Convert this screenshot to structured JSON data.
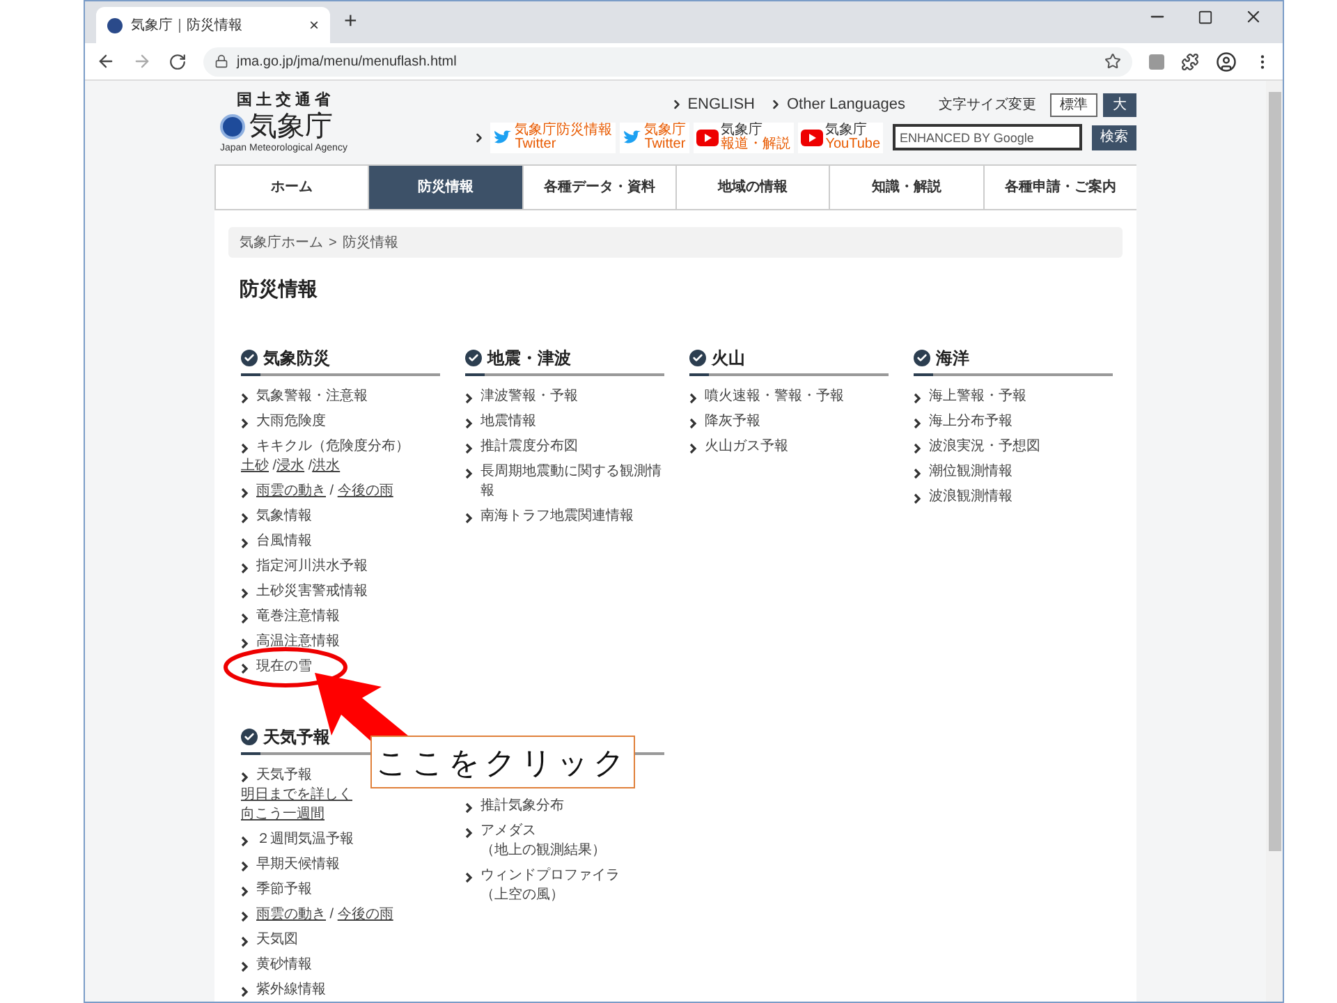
{
  "browser": {
    "tab": {
      "title": "気象庁｜防災情報",
      "close": "×"
    },
    "new_tab": "+",
    "url": "jma.go.jp/jma/menu/menuflash.html"
  },
  "header": {
    "logo": {
      "ministry": "国土交通省",
      "name": "気象庁",
      "english": "Japan Meteorological Agency"
    },
    "language_links": [
      "ENGLISH",
      "Other Languages"
    ],
    "font_size": {
      "label": "文字サイズ変更",
      "options": [
        {
          "label": "標準",
          "selected": false
        },
        {
          "label": "大",
          "selected": true
        }
      ]
    },
    "social": [
      {
        "kind": "twitter",
        "name": "気象庁防災情報",
        "service": "Twitter"
      },
      {
        "kind": "twitter",
        "name": "気象庁",
        "service": "Twitter"
      },
      {
        "kind": "youtube",
        "name": "気象庁",
        "service": "報道・解説"
      },
      {
        "kind": "youtube",
        "name": "気象庁",
        "service": "YouTube"
      }
    ],
    "search": {
      "placeholder": "ENHANCED BY Google",
      "button": "検索"
    }
  },
  "nav": [
    {
      "label": "ホーム",
      "selected": false
    },
    {
      "label": "防災情報",
      "selected": true
    },
    {
      "label": "各種データ・資料",
      "selected": false
    },
    {
      "label": "地域の情報",
      "selected": false
    },
    {
      "label": "知識・解説",
      "selected": false
    },
    {
      "label": "各種申請・ご案内",
      "selected": false
    }
  ],
  "breadcrumb": {
    "items": [
      "気象庁ホーム",
      "防災情報"
    ],
    "separator": ">"
  },
  "page_title": "防災情報",
  "sections": [
    {
      "heading": "気象防災",
      "items": [
        {
          "kind": "plain",
          "text": "気象警報・注意報"
        },
        {
          "kind": "plain",
          "text": "大雨危険度"
        },
        {
          "kind": "linked",
          "lines": [
            [
              {
                "text": "キキクル（危険度分布）",
                "underline": false
              }
            ],
            [
              {
                "text": "土砂",
                "underline": true
              },
              {
                "text": " /",
                "underline": false
              },
              {
                "text": "浸水",
                "underline": true
              },
              {
                "text": " /",
                "underline": false
              },
              {
                "text": "洪水",
                "underline": true
              }
            ]
          ]
        },
        {
          "kind": "linked",
          "lines": [
            [
              {
                "text": "雨雲の動き",
                "underline": true
              },
              {
                "text": " / ",
                "underline": false
              },
              {
                "text": "今後の雨",
                "underline": true
              }
            ]
          ]
        },
        {
          "kind": "plain",
          "text": "気象情報"
        },
        {
          "kind": "plain",
          "text": "台風情報"
        },
        {
          "kind": "plain",
          "text": "指定河川洪水予報"
        },
        {
          "kind": "plain",
          "text": "土砂災害警戒情報"
        },
        {
          "kind": "plain",
          "text": "竜巻注意情報"
        },
        {
          "kind": "plain",
          "text": "高温注意情報"
        },
        {
          "kind": "plain",
          "text": "現在の雪"
        }
      ]
    },
    {
      "heading": "地震・津波",
      "items": [
        {
          "kind": "plain",
          "text": "津波警報・予報"
        },
        {
          "kind": "plain",
          "text": "地震情報"
        },
        {
          "kind": "plain",
          "text": "推計震度分布図"
        },
        {
          "kind": "plain",
          "text": "長周期地震動に関する観測情報"
        },
        {
          "kind": "plain",
          "text": "南海トラフ地震関連情報"
        }
      ]
    },
    {
      "heading": "火山",
      "items": [
        {
          "kind": "plain",
          "text": "噴火速報・警報・予報"
        },
        {
          "kind": "plain",
          "text": "降灰予報"
        },
        {
          "kind": "plain",
          "text": "火山ガス予報"
        }
      ]
    },
    {
      "heading": "海洋",
      "items": [
        {
          "kind": "plain",
          "text": "海上警報・予報"
        },
        {
          "kind": "plain",
          "text": "海上分布予報"
        },
        {
          "kind": "plain",
          "text": "波浪実況・予想図"
        },
        {
          "kind": "plain",
          "text": "潮位観測情報"
        },
        {
          "kind": "plain",
          "text": "波浪観測情報"
        }
      ]
    },
    {
      "heading": "天気予報",
      "items": [
        {
          "kind": "linked",
          "lines": [
            [
              {
                "text": "天気予報",
                "underline": false
              }
            ],
            [
              {
                "text": "明日までを詳しく",
                "underline": true
              }
            ],
            [
              {
                "text": "向こう一週間",
                "underline": true
              }
            ]
          ]
        },
        {
          "kind": "plain",
          "text": "２週間気温予報"
        },
        {
          "kind": "plain",
          "text": "早期天候情報"
        },
        {
          "kind": "plain",
          "text": "季節予報"
        },
        {
          "kind": "linked",
          "lines": [
            [
              {
                "text": "雨雲の動き",
                "underline": true
              },
              {
                "text": " / ",
                "underline": false
              },
              {
                "text": "今後の雨",
                "underline": true
              }
            ]
          ]
        },
        {
          "kind": "plain",
          "text": "天気図"
        },
        {
          "kind": "plain",
          "text": "黄砂情報"
        },
        {
          "kind": "plain",
          "text": "紫外線情報"
        }
      ]
    },
    {
      "items": [
        {
          "kind": "plain",
          "text": "推計気象分布"
        },
        {
          "kind": "linked",
          "lines": [
            [
              {
                "text": "アメダス",
                "underline": false
              }
            ],
            [
              {
                "text": "（地上の観測結果）",
                "underline": false
              }
            ]
          ]
        },
        {
          "kind": "linked",
          "lines": [
            [
              {
                "text": "ウィンドプロファイラ",
                "underline": false
              }
            ],
            [
              {
                "text": "（上空の風）",
                "underline": false
              }
            ]
          ]
        }
      ]
    }
  ],
  "annotation": {
    "callout": "ここをクリック"
  }
}
